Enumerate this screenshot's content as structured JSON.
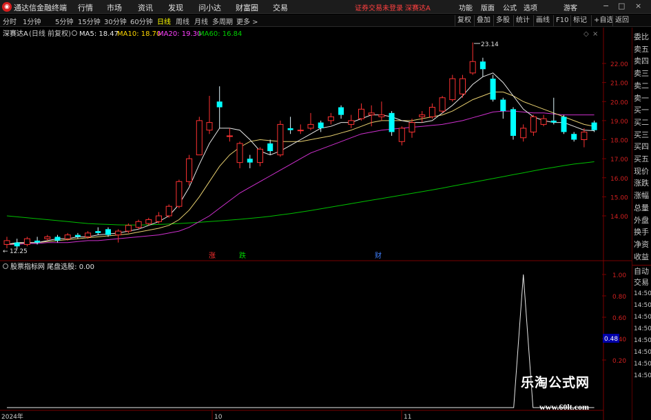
{
  "app": {
    "title": "通达信金融终端",
    "menus": [
      "行情",
      "市场",
      "资讯",
      "发现",
      "问小达",
      "财富圈",
      "交易"
    ],
    "trade_status": "证券交易未登录",
    "stock_link": "深赛达A",
    "right_buttons": [
      "功能",
      "版面",
      "公式",
      "选项"
    ],
    "user": "游客",
    "window_controls": [
      "−",
      "□",
      "×"
    ]
  },
  "periods": {
    "items": [
      "分时",
      "1分钟",
      "5分钟",
      "15分钟",
      "30分钟",
      "60分钟",
      "日线",
      "周线",
      "月线",
      "多周期",
      "更多 >"
    ],
    "active": "日线",
    "toolbar": [
      "复权",
      "叠加",
      "多股",
      "统计",
      "画线",
      "F10",
      "标记",
      "+自选",
      "返回"
    ]
  },
  "main_chart": {
    "stock_name": "深赛达A",
    "period_label": "(日线 前复权)",
    "ma_labels": [
      {
        "text": "MA5: 18.47",
        "color": "#e8e8e8"
      },
      {
        "text": "MA10: 18.70",
        "color": "#ffd700"
      },
      {
        "text": "MA20: 19.30",
        "color": "#ff40ff"
      },
      {
        "text": "MA60: 16.84",
        "color": "#00d000"
      }
    ],
    "high_label": "23.14",
    "low_label": "12.25",
    "event_marks": [
      {
        "text": "涨",
        "color": "#ff3030"
      },
      {
        "text": "跌",
        "color": "#00d000"
      },
      {
        "text": "财",
        "color": "#4080ff"
      }
    ]
  },
  "chart_data": {
    "type": "candlestick",
    "price_axis": [
      "22.00",
      "21.00",
      "20.00",
      "19.00",
      "18.00",
      "17.00",
      "16.00",
      "15.00",
      "14.00"
    ],
    "candles": [
      {
        "o": 12.5,
        "c": 12.7,
        "h": 12.9,
        "l": 12.3
      },
      {
        "o": 12.6,
        "c": 12.4,
        "h": 12.8,
        "l": 12.25
      },
      {
        "o": 12.5,
        "c": 12.8,
        "h": 12.9,
        "l": 12.4
      },
      {
        "o": 12.7,
        "c": 12.6,
        "h": 12.9,
        "l": 12.5
      },
      {
        "o": 12.8,
        "c": 12.9,
        "h": 13.0,
        "l": 12.7
      },
      {
        "o": 12.9,
        "c": 12.7,
        "h": 13.0,
        "l": 12.6
      },
      {
        "o": 12.8,
        "c": 13.0,
        "h": 13.1,
        "l": 12.7
      },
      {
        "o": 13.0,
        "c": 12.9,
        "h": 13.1,
        "l": 12.8
      },
      {
        "o": 12.9,
        "c": 13.1,
        "h": 13.2,
        "l": 12.8
      },
      {
        "o": 13.2,
        "c": 13.1,
        "h": 13.4,
        "l": 13.0
      },
      {
        "o": 13.3,
        "c": 13.0,
        "h": 13.4,
        "l": 12.9
      },
      {
        "o": 13.0,
        "c": 13.2,
        "h": 13.3,
        "l": 12.6
      },
      {
        "o": 13.2,
        "c": 13.5,
        "h": 13.6,
        "l": 13.1
      },
      {
        "o": 13.4,
        "c": 13.7,
        "h": 13.8,
        "l": 13.3
      },
      {
        "o": 13.6,
        "c": 13.8,
        "h": 13.9,
        "l": 13.5
      },
      {
        "o": 13.7,
        "c": 14.0,
        "h": 14.2,
        "l": 13.6
      },
      {
        "o": 14.0,
        "c": 14.5,
        "h": 14.6,
        "l": 13.9
      },
      {
        "o": 14.5,
        "c": 15.8,
        "h": 15.9,
        "l": 14.4
      },
      {
        "o": 15.8,
        "c": 17.0,
        "h": 17.2,
        "l": 15.6
      },
      {
        "o": 17.2,
        "c": 19.0,
        "h": 19.2,
        "l": 17.9
      },
      {
        "o": 18.5,
        "c": 18.9,
        "h": 20.3,
        "l": 18.3
      },
      {
        "o": 20.0,
        "c": 19.7,
        "h": 20.8,
        "l": 18.6
      },
      {
        "o": 18.2,
        "c": 18.2,
        "h": 18.6,
        "l": 17.9
      },
      {
        "o": 16.8,
        "c": 17.8,
        "h": 17.9,
        "l": 16.5
      },
      {
        "o": 17.0,
        "c": 16.8,
        "h": 17.2,
        "l": 16.5
      },
      {
        "o": 16.8,
        "c": 17.5,
        "h": 17.6,
        "l": 16.6
      },
      {
        "o": 17.8,
        "c": 17.4,
        "h": 18.0,
        "l": 17.2
      },
      {
        "o": 17.2,
        "c": 18.8,
        "h": 19.0,
        "l": 17.1
      },
      {
        "o": 18.6,
        "c": 18.5,
        "h": 19.2,
        "l": 18.3
      },
      {
        "o": 18.5,
        "c": 18.5,
        "h": 18.8,
        "l": 18.3
      },
      {
        "o": 18.6,
        "c": 18.8,
        "h": 19.4,
        "l": 18.5
      },
      {
        "o": 18.9,
        "c": 18.6,
        "h": 19.0,
        "l": 18.4
      },
      {
        "o": 19.0,
        "c": 19.2,
        "h": 19.4,
        "l": 18.8
      },
      {
        "o": 19.7,
        "c": 19.3,
        "h": 19.8,
        "l": 19.1
      },
      {
        "o": 18.8,
        "c": 19.0,
        "h": 19.3,
        "l": 18.6
      },
      {
        "o": 19.1,
        "c": 19.6,
        "h": 19.9,
        "l": 19.0
      },
      {
        "o": 19.3,
        "c": 19.4,
        "h": 19.8,
        "l": 18.7
      },
      {
        "o": 19.2,
        "c": 19.3,
        "h": 20.0,
        "l": 19.0
      },
      {
        "o": 19.4,
        "c": 18.4,
        "h": 19.5,
        "l": 18.2
      },
      {
        "o": 17.9,
        "c": 18.6,
        "h": 18.7,
        "l": 17.7
      },
      {
        "o": 18.4,
        "c": 18.9,
        "h": 19.1,
        "l": 18.1
      },
      {
        "o": 19.2,
        "c": 19.3,
        "h": 19.5,
        "l": 18.9
      },
      {
        "o": 19.2,
        "c": 19.7,
        "h": 19.9,
        "l": 19.1
      },
      {
        "o": 19.5,
        "c": 20.2,
        "h": 20.3,
        "l": 19.4
      },
      {
        "o": 20.1,
        "c": 21.2,
        "h": 21.4,
        "l": 20.0
      },
      {
        "o": 20.4,
        "c": 21.2,
        "h": 21.4,
        "l": 20.2
      },
      {
        "o": 21.5,
        "c": 22.1,
        "h": 23.1,
        "l": 21.4
      },
      {
        "o": 22.1,
        "c": 21.7,
        "h": 22.3,
        "l": 21.3
      },
      {
        "o": 21.2,
        "c": 20.1,
        "h": 21.4,
        "l": 20.0
      },
      {
        "o": 20.1,
        "c": 19.5,
        "h": 20.2,
        "l": 19.1
      },
      {
        "o": 19.6,
        "c": 18.2,
        "h": 19.7,
        "l": 18.0
      },
      {
        "o": 18.1,
        "c": 18.6,
        "h": 18.8,
        "l": 17.9
      },
      {
        "o": 18.4,
        "c": 19.2,
        "h": 19.3,
        "l": 18.2
      },
      {
        "o": 18.8,
        "c": 19.1,
        "h": 19.3,
        "l": 18.7
      },
      {
        "o": 19.0,
        "c": 18.9,
        "h": 20.2,
        "l": 18.8
      },
      {
        "o": 19.2,
        "c": 18.4,
        "h": 19.3,
        "l": 18.3
      },
      {
        "o": 18.3,
        "c": 18.0,
        "h": 18.4,
        "l": 17.9
      },
      {
        "o": 18.0,
        "c": 18.4,
        "h": 18.6,
        "l": 17.6
      },
      {
        "o": 18.9,
        "c": 18.5,
        "h": 19.0,
        "l": 18.4
      }
    ],
    "ma5": [
      12.5,
      12.6,
      12.6,
      12.6,
      12.7,
      12.8,
      12.8,
      12.9,
      12.9,
      13.0,
      13.05,
      13.1,
      13.2,
      13.3,
      13.5,
      13.7,
      14.0,
      14.6,
      15.5,
      16.7,
      17.8,
      18.6,
      18.6,
      18.5,
      18.0,
      17.4,
      17.2,
      17.4,
      17.7,
      18.0,
      18.3,
      18.6,
      18.7,
      18.9,
      18.9,
      19.1,
      19.3,
      19.3,
      19.2,
      19.0,
      18.9,
      18.9,
      19.0,
      19.4,
      19.8,
      20.3,
      20.9,
      21.3,
      21.5,
      21.0,
      20.3,
      19.6,
      19.2,
      19.0,
      18.9,
      18.9,
      18.7,
      18.5,
      18.47
    ],
    "ma10": [
      12.5,
      12.55,
      12.6,
      12.6,
      12.65,
      12.7,
      12.75,
      12.8,
      12.85,
      12.9,
      12.95,
      13.0,
      13.05,
      13.15,
      13.25,
      13.35,
      13.5,
      13.8,
      14.3,
      15.0,
      15.8,
      16.6,
      17.2,
      17.6,
      17.9,
      18.0,
      17.95,
      17.9,
      17.9,
      17.9,
      18.0,
      18.1,
      18.2,
      18.35,
      18.5,
      18.7,
      18.9,
      19.0,
      19.0,
      19.0,
      19.0,
      19.1,
      19.2,
      19.3,
      19.5,
      19.8,
      20.1,
      20.3,
      20.5,
      20.5,
      20.3,
      20.0,
      19.8,
      19.6,
      19.4,
      19.2,
      19.0,
      18.8,
      18.7
    ],
    "ma20": [
      12.5,
      12.5,
      12.55,
      12.55,
      12.6,
      12.6,
      12.6,
      12.65,
      12.7,
      12.7,
      12.75,
      12.8,
      12.85,
      12.9,
      12.95,
      13.0,
      13.1,
      13.2,
      13.4,
      13.7,
      14.0,
      14.4,
      14.8,
      15.2,
      15.5,
      15.8,
      16.1,
      16.4,
      16.7,
      17.0,
      17.3,
      17.5,
      17.7,
      17.9,
      18.1,
      18.3,
      18.4,
      18.5,
      18.55,
      18.6,
      18.65,
      18.7,
      18.75,
      18.8,
      18.9,
      19.0,
      19.15,
      19.3,
      19.45,
      19.5,
      19.5,
      19.45,
      19.4,
      19.4,
      19.35,
      19.3,
      19.3,
      19.3,
      19.3
    ],
    "ma60": [
      14.0,
      13.95,
      13.9,
      13.85,
      13.8,
      13.75,
      13.7,
      13.65,
      13.6,
      13.57,
      13.55,
      13.53,
      13.52,
      13.52,
      13.53,
      13.55,
      13.57,
      13.6,
      13.63,
      13.66,
      13.7,
      13.74,
      13.78,
      13.82,
      13.87,
      13.92,
      13.98,
      14.05,
      14.12,
      14.2,
      14.28,
      14.37,
      14.46,
      14.55,
      14.64,
      14.73,
      14.82,
      14.91,
      15.0,
      15.09,
      15.18,
      15.27,
      15.36,
      15.46,
      15.56,
      15.66,
      15.76,
      15.86,
      15.96,
      16.06,
      16.16,
      16.26,
      16.36,
      16.46,
      16.55,
      16.64,
      16.72,
      16.78,
      16.84
    ]
  },
  "sub_chart": {
    "title": "股票指标网 尾盘选股: 0.00",
    "axis": [
      "1.00",
      "0.80",
      "0.60",
      "0.40",
      "0.20"
    ],
    "current_value": "0.48",
    "signal": [
      0,
      0,
      0,
      0,
      0,
      0,
      0,
      0,
      0,
      0,
      0,
      0,
      0,
      0,
      0,
      0,
      0,
      0,
      0,
      0,
      0,
      0,
      0,
      0,
      0,
      0,
      0,
      0,
      0,
      0,
      0,
      0,
      0,
      0,
      0,
      0,
      0,
      0,
      0,
      0,
      0,
      0,
      0,
      0,
      0,
      0,
      0,
      0,
      0,
      0,
      0,
      1,
      0,
      0,
      0,
      0,
      0,
      0,
      0
    ],
    "date_labels": [
      "2024年",
      "10",
      "11"
    ]
  },
  "right_panel": {
    "labels": [
      "委比",
      "卖五",
      "卖四",
      "卖三",
      "卖二",
      "卖一",
      "买一",
      "买二",
      "买三",
      "买四",
      "买五",
      "现价",
      "涨跌",
      "涨幅",
      "总量",
      "外盘",
      "换手",
      "净资",
      "收益"
    ],
    "bottom_labels": [
      "自动",
      "交易"
    ],
    "times": [
      "14:50",
      "14:50",
      "14:50",
      "14:50",
      "14:50",
      "14:50",
      "14:50",
      "14:50"
    ]
  },
  "watermark": {
    "title": "乐淘公式网",
    "url": "www.60lt.com"
  }
}
